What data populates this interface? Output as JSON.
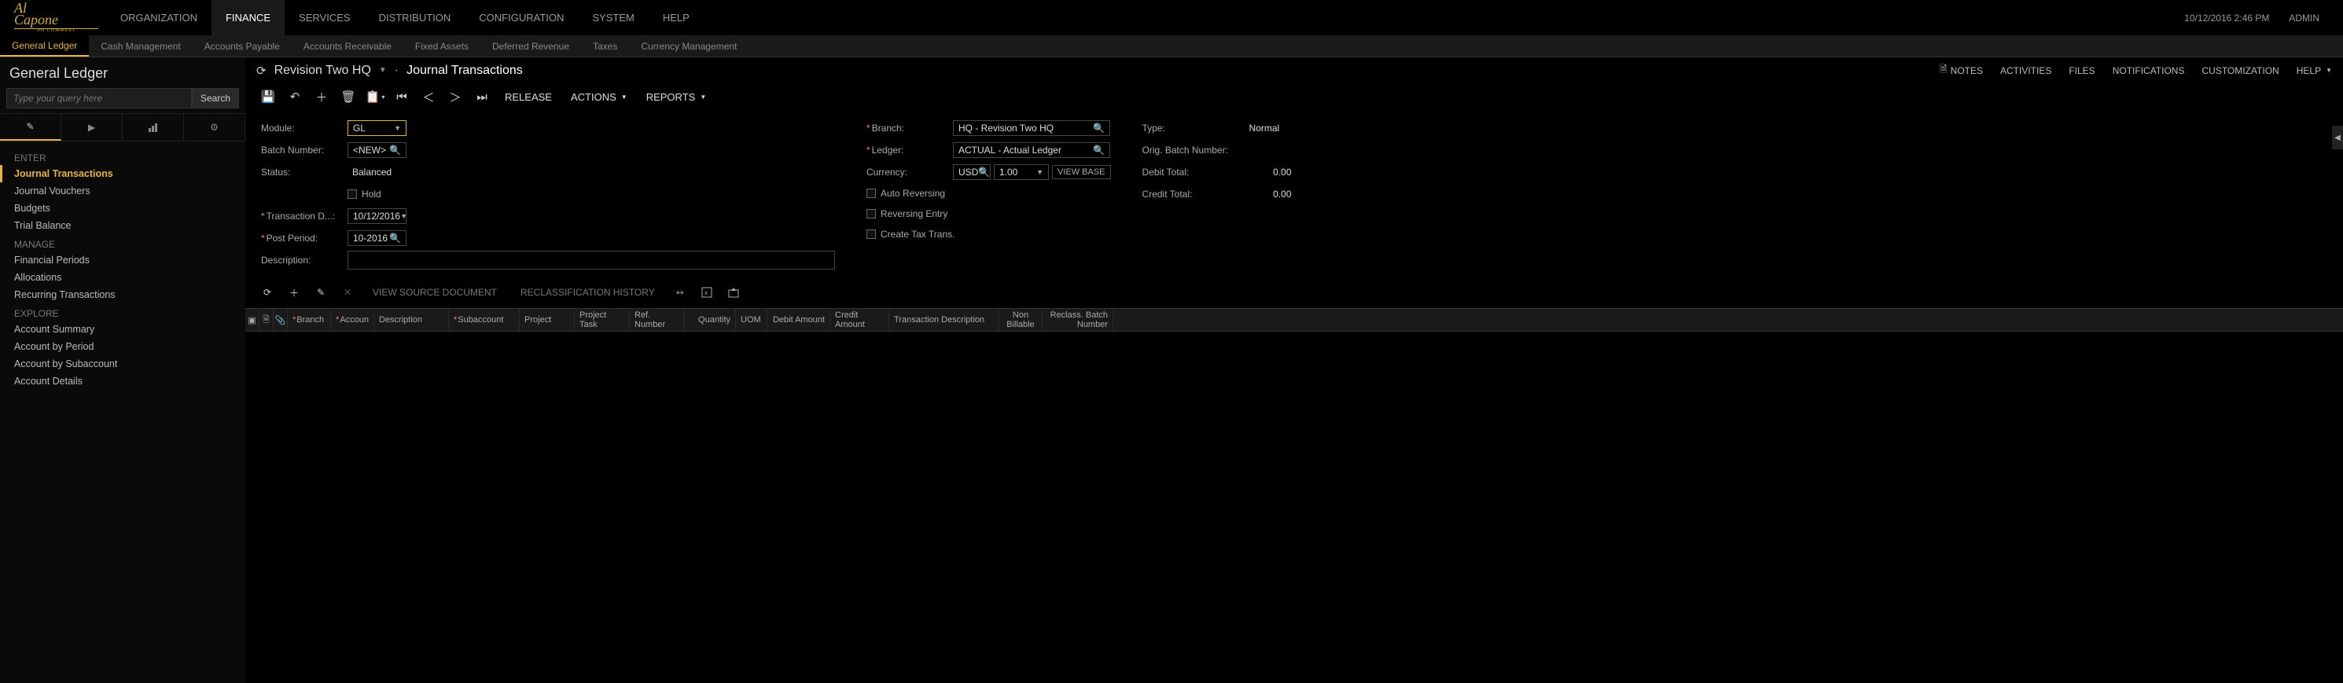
{
  "header": {
    "datetime": "10/12/2016  2:46 PM",
    "user": "ADMIN"
  },
  "main_nav": [
    "ORGANIZATION",
    "FINANCE",
    "SERVICES",
    "DISTRIBUTION",
    "CONFIGURATION",
    "SYSTEM",
    "HELP"
  ],
  "main_nav_active": "FINANCE",
  "sub_nav": [
    "General Ledger",
    "Cash Management",
    "Accounts Payable",
    "Accounts Receivable",
    "Fixed Assets",
    "Deferred Revenue",
    "Taxes",
    "Currency Management"
  ],
  "sub_nav_active": "General Ledger",
  "sidebar": {
    "title": "General Ledger",
    "search_placeholder": "Type your query here",
    "search_btn": "Search",
    "sections": [
      {
        "heading": "ENTER",
        "items": [
          "Journal Transactions",
          "Journal Vouchers",
          "Budgets",
          "Trial Balance"
        ],
        "active": "Journal Transactions"
      },
      {
        "heading": "MANAGE",
        "items": [
          "Financial Periods",
          "Allocations",
          "Recurring Transactions"
        ]
      },
      {
        "heading": "EXPLORE",
        "items": [
          "Account Summary",
          "Account by Period",
          "Account by Subaccount",
          "Account Details"
        ]
      }
    ]
  },
  "content_header": {
    "org": "Revision Two HQ",
    "page": "Journal Transactions",
    "right": [
      "NOTES",
      "ACTIVITIES",
      "FILES",
      "NOTIFICATIONS",
      "CUSTOMIZATION",
      "HELP"
    ]
  },
  "toolbar": {
    "release": "RELEASE",
    "actions": "ACTIONS",
    "reports": "REPORTS"
  },
  "form": {
    "module_label": "Module:",
    "module_value": "GL",
    "batch_label": "Batch Number:",
    "batch_value": "<NEW>",
    "status_label": "Status:",
    "status_value": "Balanced",
    "hold_label": "Hold",
    "transdate_label": "Transaction D...:",
    "transdate_value": "10/12/2016",
    "postperiod_label": "Post Period:",
    "postperiod_value": "10-2016",
    "description_label": "Description:",
    "branch_label": "Branch:",
    "branch_value": "HQ - Revision Two HQ",
    "ledger_label": "Ledger:",
    "ledger_value": "ACTUAL - Actual Ledger",
    "currency_label": "Currency:",
    "currency_value": "USD",
    "rate_value": "1.00",
    "viewbase": "VIEW BASE",
    "autorev_label": "Auto Reversing",
    "reventry_label": "Reversing Entry",
    "createtax_label": "Create Tax Trans.",
    "type_label": "Type:",
    "type_value": "Normal",
    "origbatch_label": "Orig. Batch Number:",
    "debit_label": "Debit Total:",
    "debit_value": "0.00",
    "credit_label": "Credit Total:",
    "credit_value": "0.00"
  },
  "grid_toolbar": {
    "viewsource": "VIEW SOURCE DOCUMENT",
    "reclass": "RECLASSIFICATION HISTORY"
  },
  "grid_columns": [
    "Branch",
    "Accoun",
    "Description",
    "Subaccount",
    "Project",
    "Project Task",
    "Ref. Number",
    "Quantity",
    "UOM",
    "Debit Amount",
    "Credit Amount",
    "Transaction Description",
    "Non Billable",
    "Reclass. Batch Number"
  ]
}
